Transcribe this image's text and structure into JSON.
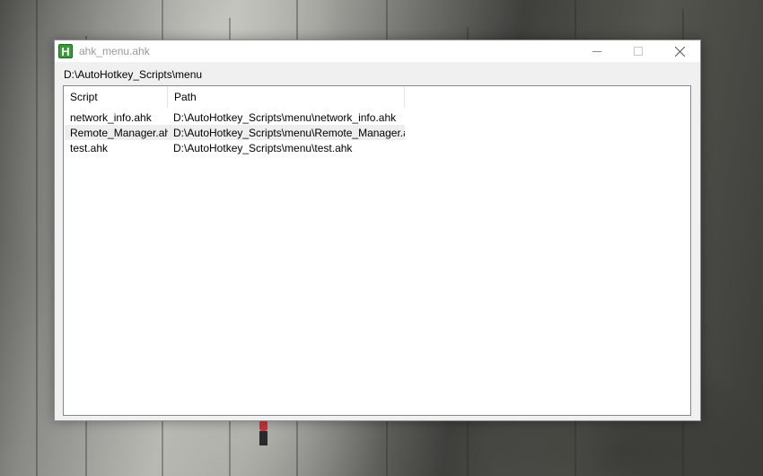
{
  "window": {
    "title": "ahk_menu.ahk",
    "app_icon_letter": "H",
    "controls": [
      "minimize",
      "maximize",
      "close"
    ]
  },
  "current_folder": "D:\\AutoHotkey_Scripts\\menu",
  "list": {
    "columns": [
      "Script",
      "Path"
    ],
    "rows": [
      {
        "script": "network_info.ahk",
        "path": "D:\\AutoHotkey_Scripts\\menu\\network_info.ahk"
      },
      {
        "script": "Remote_Manager.ahk",
        "path": "D:\\AutoHotkey_Scripts\\menu\\Remote_Manager.ahk"
      },
      {
        "script": "test.ahk",
        "path": "D:\\AutoHotkey_Scripts\\menu\\test.ahk"
      }
    ],
    "hovered_row": 1
  },
  "colors": {
    "titlebar": "#ffffff",
    "window_bg": "#f0f0f0",
    "list_bg": "#ffffff",
    "hover_row": "#eeeeee",
    "app_icon": "#3a9a3a"
  }
}
